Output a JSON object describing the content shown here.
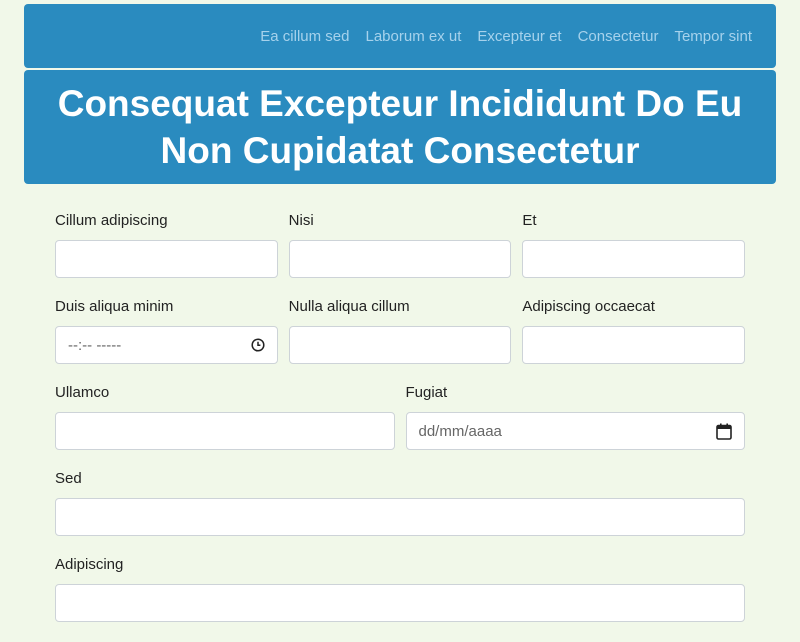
{
  "nav": {
    "links": [
      "Ea cillum sed",
      "Laborum ex ut",
      "Excepteur et",
      "Consectetur",
      "Tempor sint"
    ]
  },
  "header": {
    "title": "Consequat Excepteur Incididunt Do Eu Non Cupidatat Consectetur"
  },
  "form": {
    "row1": {
      "field1": {
        "label": "Cillum adipiscing",
        "value": ""
      },
      "field2": {
        "label": "Nisi",
        "value": ""
      },
      "field3": {
        "label": "Et",
        "value": ""
      }
    },
    "row2": {
      "field1": {
        "label": "Duis aliqua minim",
        "value": "--:-- -----",
        "icon": "clock-icon"
      },
      "field2": {
        "label": "Nulla aliqua cillum",
        "value": ""
      },
      "field3": {
        "label": "Adipiscing occaecat",
        "value": ""
      }
    },
    "row3": {
      "field1": {
        "label": "Ullamco",
        "value": ""
      },
      "field2": {
        "label": "Fugiat",
        "value": "dd/mm/aaaa",
        "icon": "calendar-icon"
      }
    },
    "row4": {
      "field1": {
        "label": "Sed",
        "value": ""
      }
    },
    "row5": {
      "field1": {
        "label": "Adipiscing",
        "value": ""
      }
    }
  },
  "colors": {
    "background": "#f1f8e9",
    "primary": "#2a8bbf",
    "nav_link": "#a6d2ec"
  }
}
